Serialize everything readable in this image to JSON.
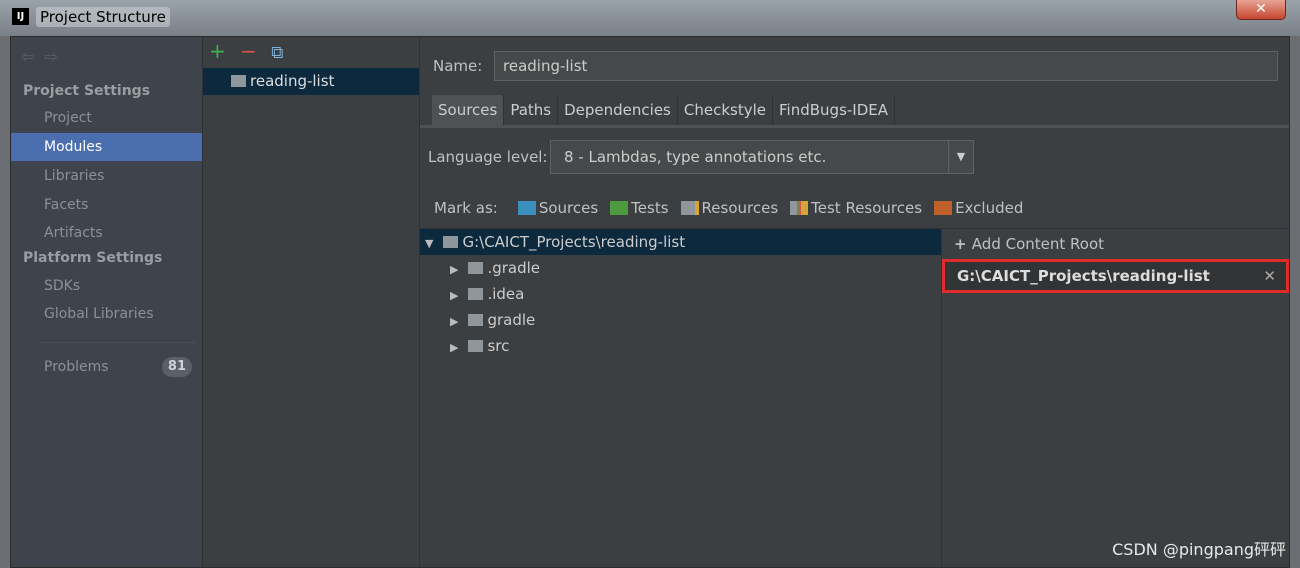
{
  "window": {
    "title": "Project Structure",
    "logo": "IJ",
    "close": "✕"
  },
  "sidebar": {
    "project_settings": "Project Settings",
    "platform_settings": "Platform Settings",
    "items": [
      {
        "label": "Project"
      },
      {
        "label": "Modules"
      },
      {
        "label": "Libraries"
      },
      {
        "label": "Facets"
      },
      {
        "label": "Artifacts"
      }
    ],
    "platform_items": [
      {
        "label": "SDKs"
      },
      {
        "label": "Global Libraries"
      }
    ],
    "problems": {
      "label": "Problems",
      "count": "81"
    },
    "selected_color": "#4b6eaf"
  },
  "modules": {
    "items": [
      {
        "label": "reading-list"
      }
    ]
  },
  "main": {
    "name_label": "Name:",
    "name_value": "reading-list",
    "tabs": [
      {
        "label": "Sources"
      },
      {
        "label": "Paths"
      },
      {
        "label": "Dependencies"
      },
      {
        "label": "Checkstyle"
      },
      {
        "label": "FindBugs-IDEA"
      }
    ],
    "language_label": "Language level:",
    "language_value": "8 - Lambdas, type annotations etc.",
    "mark_as": {
      "label": "Mark as:",
      "items": [
        {
          "label": "Sources",
          "color": "#3b8fbf"
        },
        {
          "label": "Tests",
          "color": "#4e9a3e"
        },
        {
          "label": "Resources",
          "color": "#8f969c"
        },
        {
          "label": "Test Resources",
          "color": "#8f969c"
        },
        {
          "label": "Excluded",
          "color": "#c0602a"
        }
      ]
    },
    "tree": {
      "root": "G:\\CAICT_Projects\\reading-list",
      "children": [
        {
          "label": ".gradle"
        },
        {
          "label": ".idea"
        },
        {
          "label": "gradle"
        },
        {
          "label": "src"
        }
      ]
    },
    "add_content_root": "Add Content Root",
    "content_root": "G:\\CAICT_Projects\\reading-list"
  },
  "watermark": "CSDN @pingpang砰砰"
}
